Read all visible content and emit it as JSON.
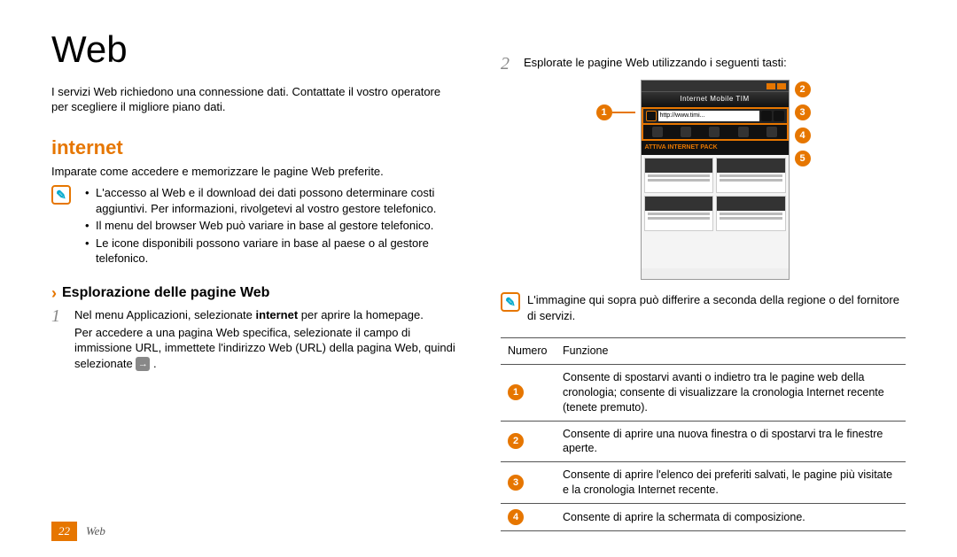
{
  "title": "Web",
  "intro": "I servizi Web richiedono una connessione dati. Contattate il vostro operatore per scegliere il migliore piano dati.",
  "section": {
    "heading": "internet",
    "lead": "Imparate come accedere e memorizzare le pagine Web preferite.",
    "note_icon_glyph": "✎",
    "notes": [
      "L'accesso al Web e il download dei dati possono determinare costi aggiuntivi. Per informazioni, rivolgetevi al vostro gestore telefonico.",
      "Il menu del browser Web può variare in base al gestore telefonico.",
      "Le icone disponibili possono variare in base al paese o al gestore telefonico."
    ]
  },
  "subhead": "Esplorazione delle pagine Web",
  "step1": {
    "num": "1",
    "line1_pre": "Nel menu Applicazioni, selezionate ",
    "line1_bold": "internet",
    "line1_post": " per aprire la homepage.",
    "line2": "Per accedere a una pagina Web specifica, selezionate il campo di immissione URL, immettete l'indirizzo Web (URL) della pagina Web, quindi selezionate ",
    "go_glyph": "→"
  },
  "step2": {
    "num": "2",
    "text": "Esplorate le pagine Web utilizzando i seguenti tasti:"
  },
  "figure": {
    "tab_title": "Internet Mobile TIM",
    "url_text": "http://www.timi...",
    "banner_text": "ATTIVA INTERNET PACK",
    "callouts_left": [
      "1"
    ],
    "callouts_right": [
      "2",
      "3",
      "4",
      "5"
    ]
  },
  "note2": "L'immagine qui sopra può differire a seconda della regione o del fornitore di servizi.",
  "table": {
    "head_numero": "Numero",
    "head_funzione": "Funzione",
    "rows": [
      {
        "n": "1",
        "f": "Consente di spostarvi avanti o indietro tra le pagine web della cronologia; consente di visualizzare la cronologia Internet recente (tenete premuto)."
      },
      {
        "n": "2",
        "f": "Consente di aprire una nuova finestra o di spostarvi tra le finestre aperte."
      },
      {
        "n": "3",
        "f": "Consente di aprire l'elenco dei preferiti salvati, le pagine più visitate e la cronologia Internet recente."
      },
      {
        "n": "4",
        "f": "Consente di aprire la schermata di composizione."
      }
    ]
  },
  "footer": {
    "page": "22",
    "section": "Web"
  }
}
